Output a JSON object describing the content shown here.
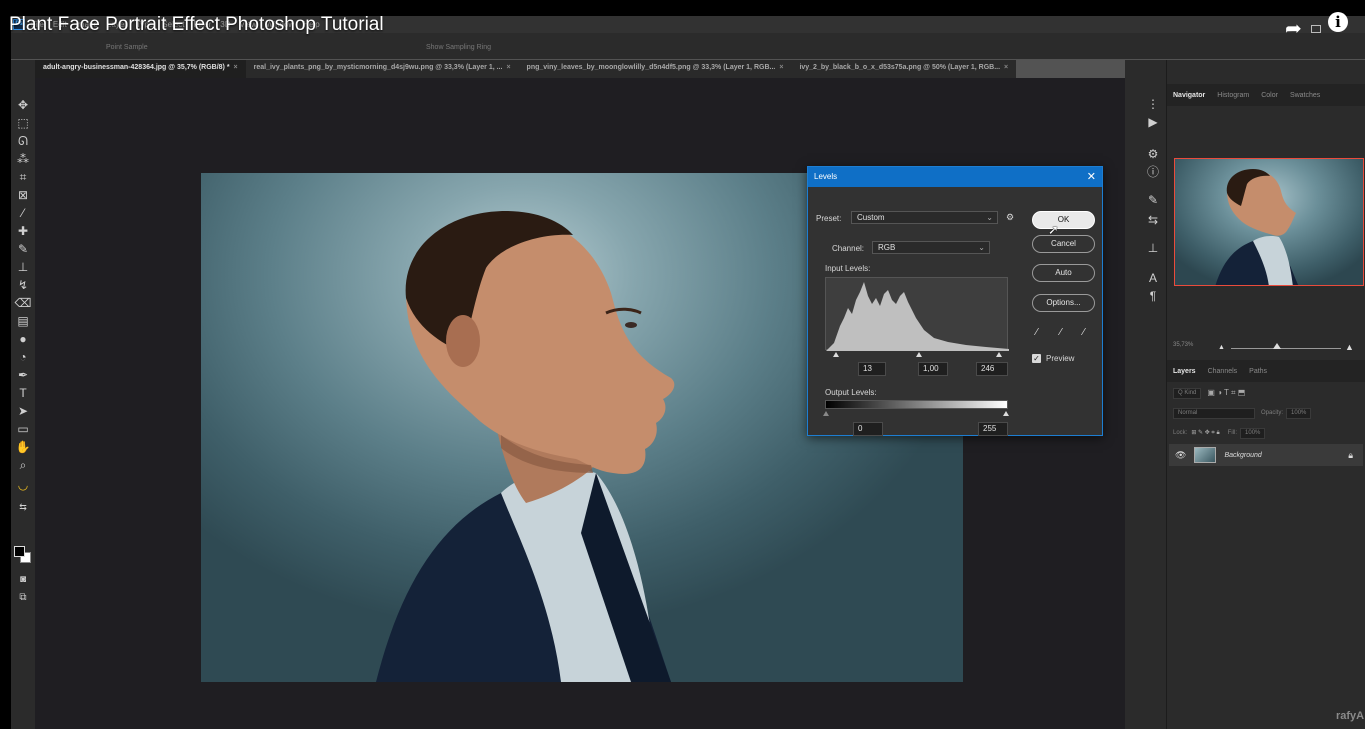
{
  "video_title": "Plant Face Portrait Effect Photoshop Tutorial",
  "menu": [
    "File",
    "Edit",
    "Image",
    "Layer",
    "Type",
    "Select",
    "Filter",
    "3D",
    "View",
    "Window",
    "Help"
  ],
  "options_bar": {
    "sample_label": "Point Sample",
    "sampling_ring": "Show Sampling Ring"
  },
  "tabs": [
    {
      "label": "adult-angry-businessman-428364.jpg @ 35,7% (RGB/8) *",
      "active": true
    },
    {
      "label": "real_ivy_plants_png_by_mysticmorning_d4sj9wu.png @ 33,3% (Layer 1, ...",
      "active": false
    },
    {
      "label": "png_viny_leaves_by_moonglowlilly_d5n4df5.png @ 33,3% (Layer 1, RGB...",
      "active": false
    },
    {
      "label": "ivy_2_by_black_b_o_x_d53s75a.png @ 50% (Layer 1, RGB...",
      "active": false
    }
  ],
  "tab_close_glyph": "×",
  "levels_dialog": {
    "title": "Levels",
    "close": "✕",
    "preset_label": "Preset:",
    "preset_value": "Custom",
    "channel_label": "Channel:",
    "channel_value": "RGB",
    "input_levels_label": "Input Levels:",
    "input_black": "13",
    "input_gamma": "1,00",
    "input_white": "246",
    "output_levels_label": "Output Levels:",
    "output_black": "0",
    "output_white": "255",
    "buttons": {
      "ok": "OK",
      "cancel": "Cancel",
      "auto": "Auto",
      "options": "Options..."
    },
    "preview_label": "Preview",
    "preview_checked": true
  },
  "panels": {
    "top_tabs": [
      "Navigator",
      "Histogram",
      "Color",
      "Swatches"
    ],
    "zoom": "35,73%",
    "layer_tabs": [
      "Layers",
      "Channels",
      "Paths"
    ],
    "kind_filter": "Q Kind",
    "blend_mode": "Normal",
    "opacity_label": "Opacity:",
    "opacity_value": "100%",
    "lock_label": "Lock:",
    "fill_label": "Fill:",
    "fill_value": "100%",
    "layers": [
      {
        "name": "Background",
        "visible": true,
        "locked": true
      }
    ]
  },
  "watermark": "rafyA",
  "colors": {
    "accent": "#0f6fc6",
    "nav_frame": "#ea4b3c"
  }
}
